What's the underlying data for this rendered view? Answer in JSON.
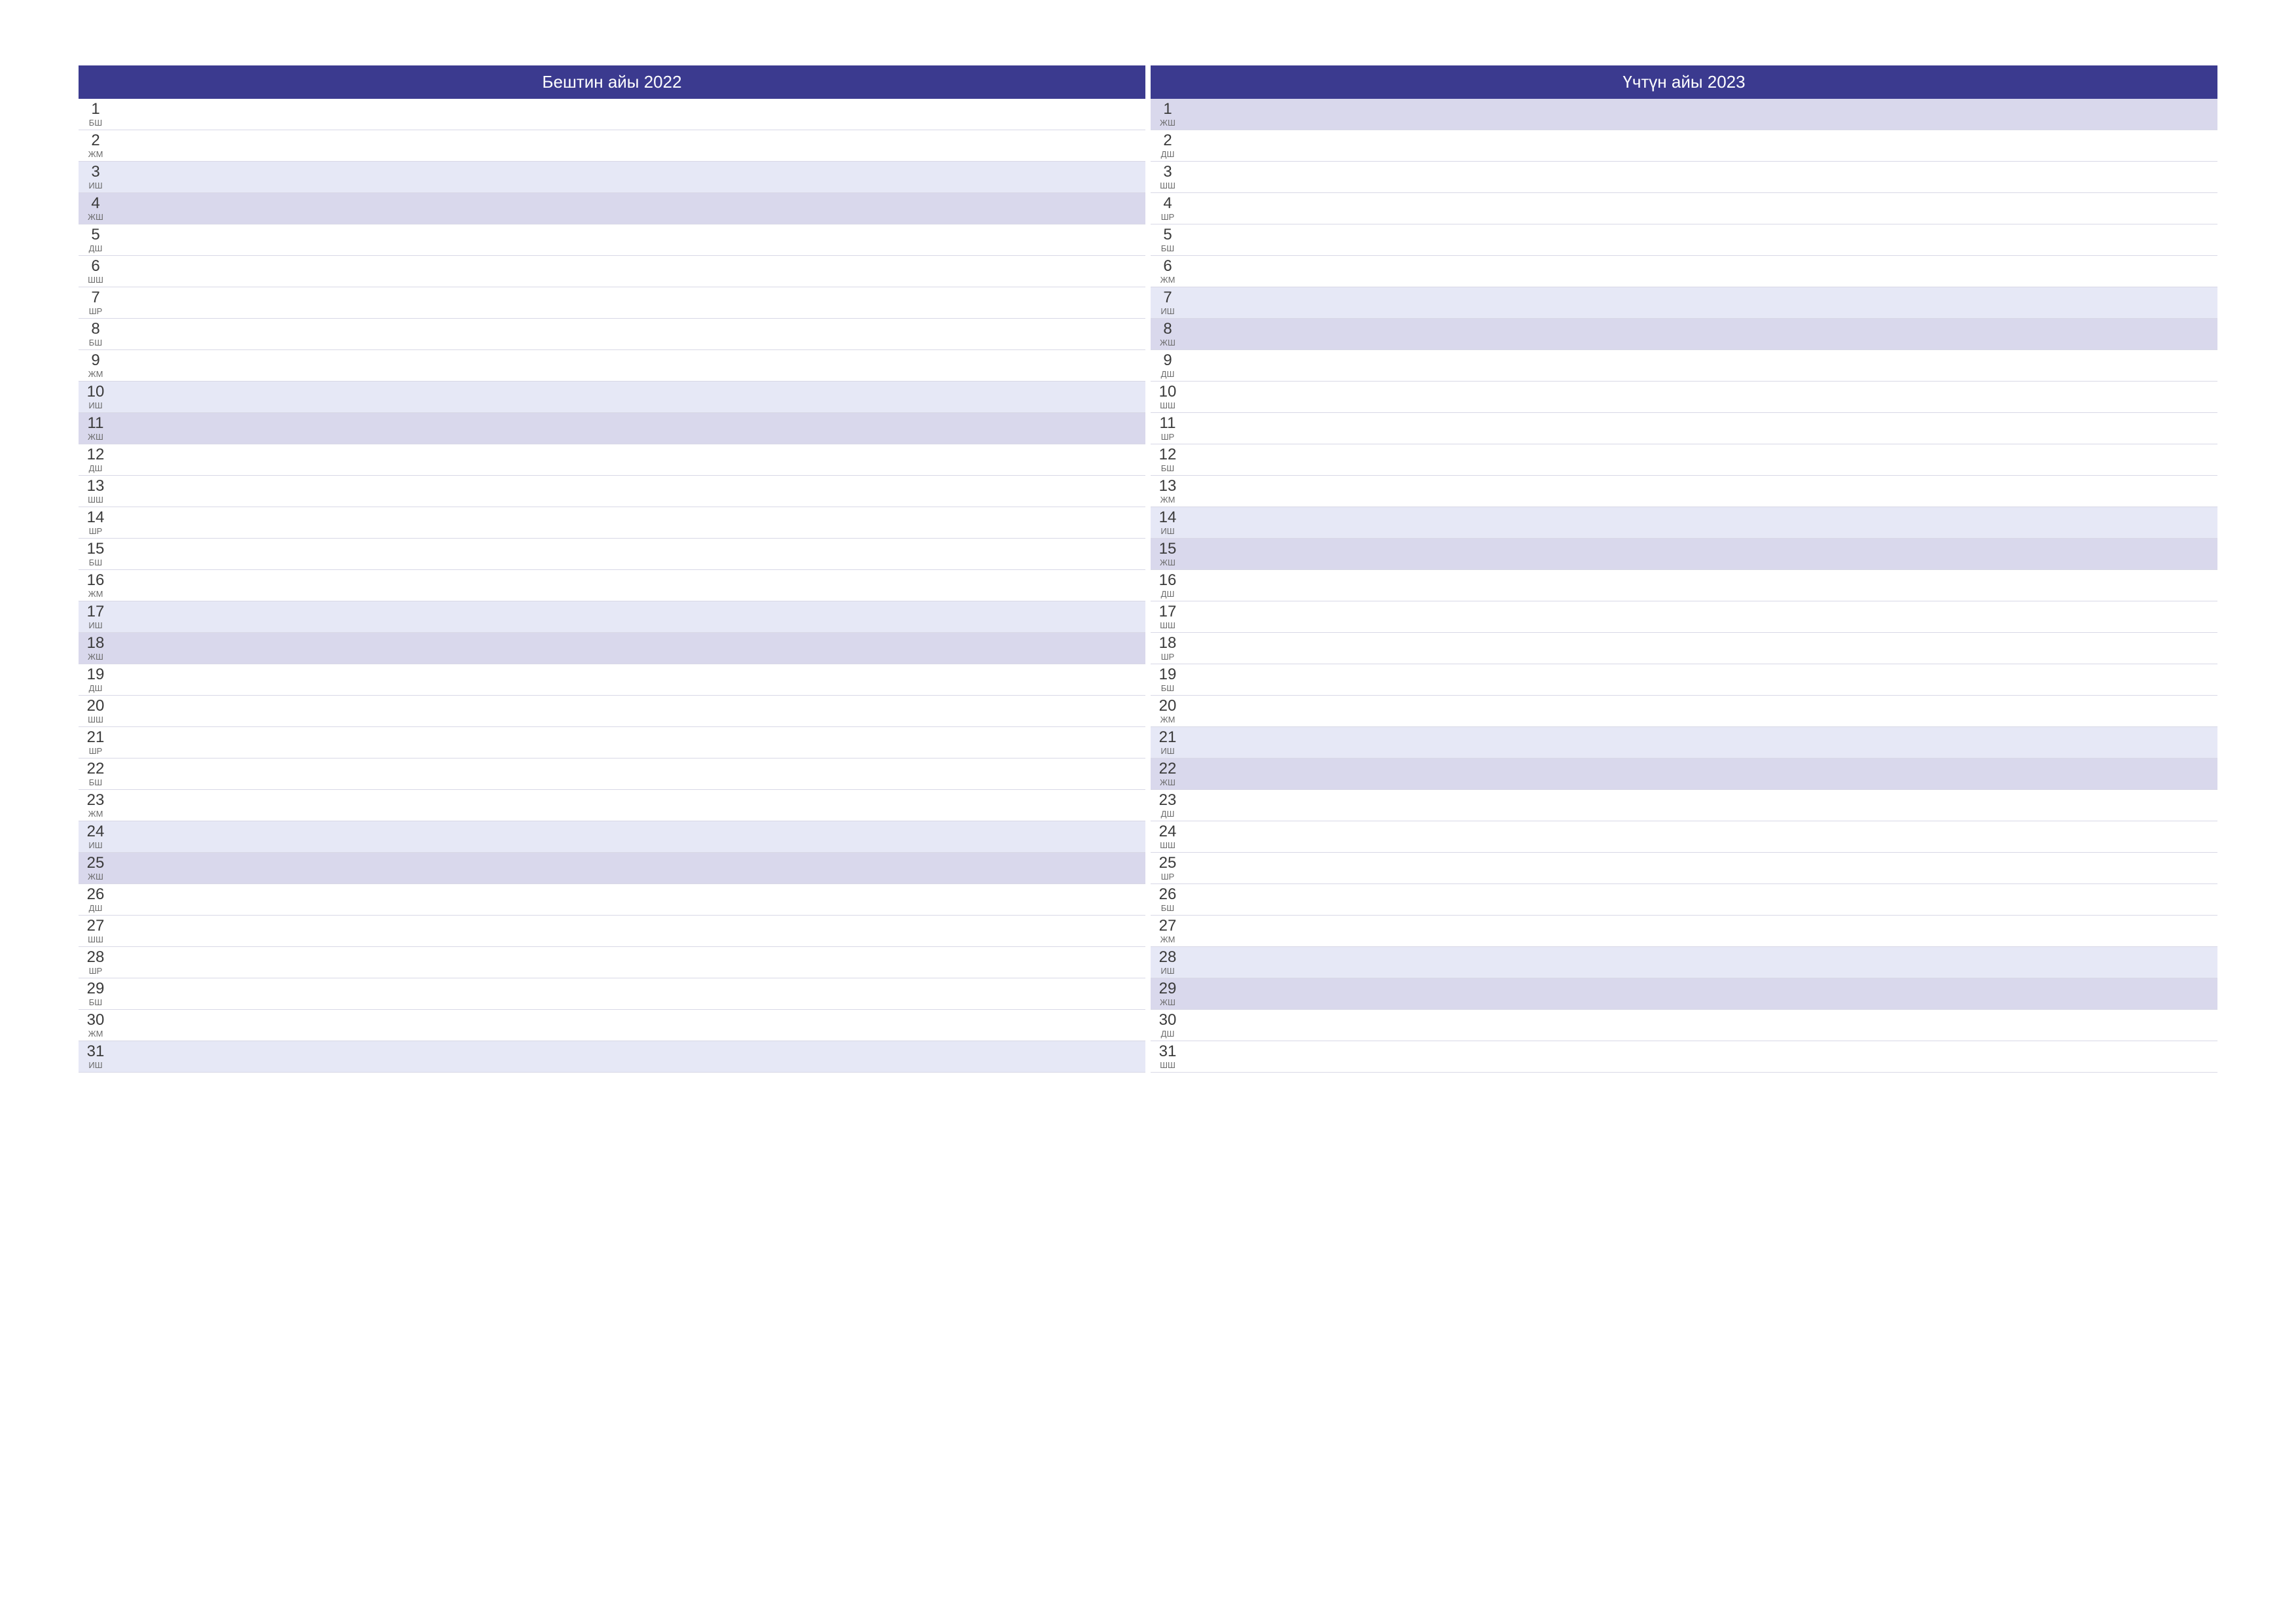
{
  "months": [
    {
      "title": "Бештин айы 2022",
      "days": [
        {
          "num": "1",
          "abbr": "БШ",
          "type": "weekday"
        },
        {
          "num": "2",
          "abbr": "ЖМ",
          "type": "weekday"
        },
        {
          "num": "3",
          "abbr": "ИШ",
          "type": "saturday"
        },
        {
          "num": "4",
          "abbr": "ЖШ",
          "type": "sunday"
        },
        {
          "num": "5",
          "abbr": "ДШ",
          "type": "weekday"
        },
        {
          "num": "6",
          "abbr": "ШШ",
          "type": "weekday"
        },
        {
          "num": "7",
          "abbr": "ШР",
          "type": "weekday"
        },
        {
          "num": "8",
          "abbr": "БШ",
          "type": "weekday"
        },
        {
          "num": "9",
          "abbr": "ЖМ",
          "type": "weekday"
        },
        {
          "num": "10",
          "abbr": "ИШ",
          "type": "saturday"
        },
        {
          "num": "11",
          "abbr": "ЖШ",
          "type": "sunday"
        },
        {
          "num": "12",
          "abbr": "ДШ",
          "type": "weekday"
        },
        {
          "num": "13",
          "abbr": "ШШ",
          "type": "weekday"
        },
        {
          "num": "14",
          "abbr": "ШР",
          "type": "weekday"
        },
        {
          "num": "15",
          "abbr": "БШ",
          "type": "weekday"
        },
        {
          "num": "16",
          "abbr": "ЖМ",
          "type": "weekday"
        },
        {
          "num": "17",
          "abbr": "ИШ",
          "type": "saturday"
        },
        {
          "num": "18",
          "abbr": "ЖШ",
          "type": "sunday"
        },
        {
          "num": "19",
          "abbr": "ДШ",
          "type": "weekday"
        },
        {
          "num": "20",
          "abbr": "ШШ",
          "type": "weekday"
        },
        {
          "num": "21",
          "abbr": "ШР",
          "type": "weekday"
        },
        {
          "num": "22",
          "abbr": "БШ",
          "type": "weekday"
        },
        {
          "num": "23",
          "abbr": "ЖМ",
          "type": "weekday"
        },
        {
          "num": "24",
          "abbr": "ИШ",
          "type": "saturday"
        },
        {
          "num": "25",
          "abbr": "ЖШ",
          "type": "sunday"
        },
        {
          "num": "26",
          "abbr": "ДШ",
          "type": "weekday"
        },
        {
          "num": "27",
          "abbr": "ШШ",
          "type": "weekday"
        },
        {
          "num": "28",
          "abbr": "ШР",
          "type": "weekday"
        },
        {
          "num": "29",
          "abbr": "БШ",
          "type": "weekday"
        },
        {
          "num": "30",
          "abbr": "ЖМ",
          "type": "weekday"
        },
        {
          "num": "31",
          "abbr": "ИШ",
          "type": "saturday"
        }
      ]
    },
    {
      "title": "Үчтүн айы 2023",
      "days": [
        {
          "num": "1",
          "abbr": "ЖШ",
          "type": "sunday"
        },
        {
          "num": "2",
          "abbr": "ДШ",
          "type": "weekday"
        },
        {
          "num": "3",
          "abbr": "ШШ",
          "type": "weekday"
        },
        {
          "num": "4",
          "abbr": "ШР",
          "type": "weekday"
        },
        {
          "num": "5",
          "abbr": "БШ",
          "type": "weekday"
        },
        {
          "num": "6",
          "abbr": "ЖМ",
          "type": "weekday"
        },
        {
          "num": "7",
          "abbr": "ИШ",
          "type": "saturday"
        },
        {
          "num": "8",
          "abbr": "ЖШ",
          "type": "sunday"
        },
        {
          "num": "9",
          "abbr": "ДШ",
          "type": "weekday"
        },
        {
          "num": "10",
          "abbr": "ШШ",
          "type": "weekday"
        },
        {
          "num": "11",
          "abbr": "ШР",
          "type": "weekday"
        },
        {
          "num": "12",
          "abbr": "БШ",
          "type": "weekday"
        },
        {
          "num": "13",
          "abbr": "ЖМ",
          "type": "weekday"
        },
        {
          "num": "14",
          "abbr": "ИШ",
          "type": "saturday"
        },
        {
          "num": "15",
          "abbr": "ЖШ",
          "type": "sunday"
        },
        {
          "num": "16",
          "abbr": "ДШ",
          "type": "weekday"
        },
        {
          "num": "17",
          "abbr": "ШШ",
          "type": "weekday"
        },
        {
          "num": "18",
          "abbr": "ШР",
          "type": "weekday"
        },
        {
          "num": "19",
          "abbr": "БШ",
          "type": "weekday"
        },
        {
          "num": "20",
          "abbr": "ЖМ",
          "type": "weekday"
        },
        {
          "num": "21",
          "abbr": "ИШ",
          "type": "saturday"
        },
        {
          "num": "22",
          "abbr": "ЖШ",
          "type": "sunday"
        },
        {
          "num": "23",
          "abbr": "ДШ",
          "type": "weekday"
        },
        {
          "num": "24",
          "abbr": "ШШ",
          "type": "weekday"
        },
        {
          "num": "25",
          "abbr": "ШР",
          "type": "weekday"
        },
        {
          "num": "26",
          "abbr": "БШ",
          "type": "weekday"
        },
        {
          "num": "27",
          "abbr": "ЖМ",
          "type": "weekday"
        },
        {
          "num": "28",
          "abbr": "ИШ",
          "type": "saturday"
        },
        {
          "num": "29",
          "abbr": "ЖШ",
          "type": "sunday"
        },
        {
          "num": "30",
          "abbr": "ДШ",
          "type": "weekday"
        },
        {
          "num": "31",
          "abbr": "ШШ",
          "type": "weekday"
        }
      ]
    }
  ]
}
